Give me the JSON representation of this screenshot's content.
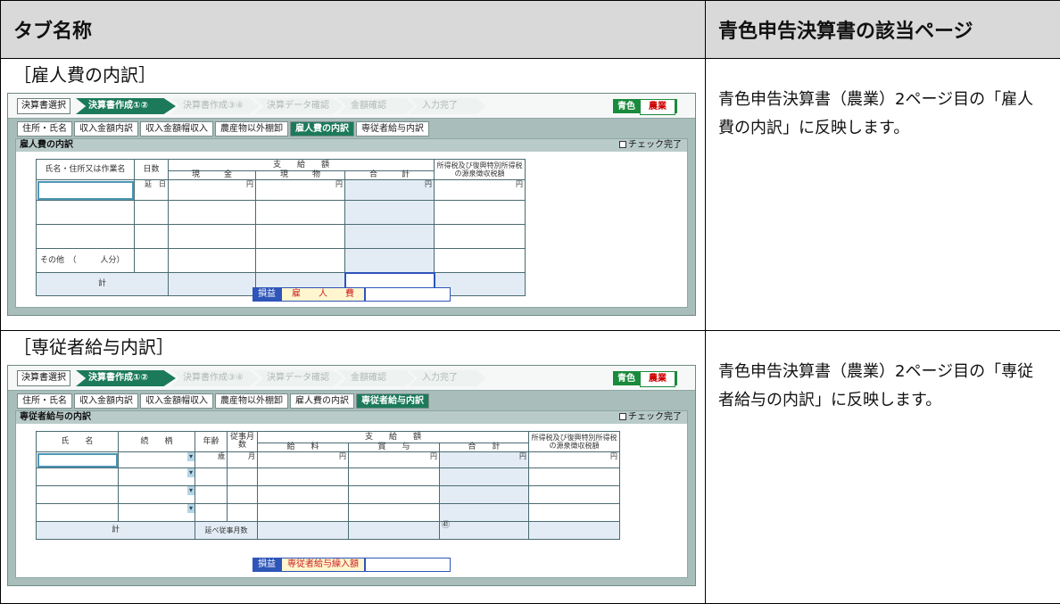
{
  "header": {
    "col1": "タブ名称",
    "col2": "青色申告決算書の該当ページ"
  },
  "rows": [
    {
      "title": "［雇人費の内訳］",
      "description": "青色申告決算書（農業）2ページ目の「雇人費の内訳」に反映します。"
    },
    {
      "title": "［専従者給与内訳］",
      "description": "青色申告決算書（農業）2ページ目の「専従者給与の内訳」に反映します。"
    }
  ],
  "app": {
    "select_button": "決算書選択",
    "steps": [
      "決算書作成①②",
      "決算書作成③④",
      "決算データ確認",
      "金額確認",
      "入力完了"
    ],
    "badge_left": "青色",
    "badge_right": "農業",
    "tabs": [
      "住所・氏名",
      "収入金額内訳",
      "収入金額帽収入",
      "農産物以外棚卸",
      "雇人費の内訳",
      "専従者給与内訳"
    ],
    "check_label": "チェック完了",
    "yen": "円",
    "day": "日",
    "age_unit": "歳",
    "month": "月"
  },
  "screen1": {
    "panel_title": "雇人費の内訳",
    "col_name": "氏名・住所又は作業名",
    "col_days": "日数",
    "col_pay_top": "支　　給　　額",
    "col_cash": "現　　　金",
    "col_goods": "現　　　物",
    "col_total": "合　　　計",
    "col_tax": "所得税及び復興特別所得税の源泉徴収税額",
    "day_prefix": "延",
    "other_label": "その他　（　　　人分）",
    "total_label": "計",
    "son_label": "損益",
    "son_value": "雇　　人　　費"
  },
  "screen2": {
    "panel_title": "専従者給与の内訳",
    "col_name": "氏　　名",
    "col_rel": "続　　柄",
    "col_age": "年齢",
    "col_months": "従事月数",
    "col_pay_top": "支　　給　　額",
    "col_salary": "給　　料",
    "col_bonus": "賞　　与",
    "col_total": "合　　計",
    "col_tax": "所得税及び復興特別所得税の源泉徴収税額",
    "total_label": "計",
    "months_total_label": "延べ従事月数",
    "total_mark": "㊶",
    "son_label": "損益",
    "son_value": "専従者給与繰入額"
  }
}
